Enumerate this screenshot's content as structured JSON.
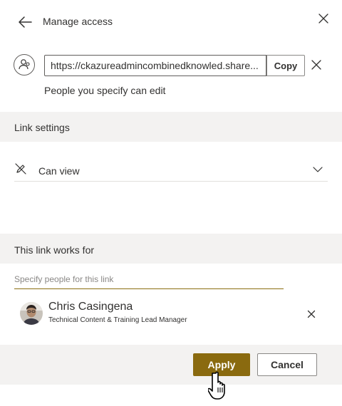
{
  "header": {
    "title": "Manage access"
  },
  "link": {
    "url": "https://ckazureadmincombinedknowled.share...",
    "copy_label": "Copy",
    "permission_summary": "People you specify can edit"
  },
  "link_settings": {
    "section_label": "Link settings",
    "permission_option": "Can view"
  },
  "audience": {
    "section_label": "This link works for",
    "input_placeholder": "Specify people for this link",
    "people": [
      {
        "name": "Chris Casingena",
        "title": "Technical Content & Training Lead Manager"
      }
    ]
  },
  "footer": {
    "apply_label": "Apply",
    "cancel_label": "Cancel"
  },
  "colors": {
    "accent": "#8a6a0f",
    "band": "#f3f2f1",
    "border": "#8a8886",
    "text": "#323130"
  },
  "icons": [
    "back-arrow-icon",
    "close-icon",
    "people-link-icon",
    "remove-icon",
    "pencil-slash-icon",
    "chevron-down-icon",
    "hand-cursor-icon"
  ]
}
